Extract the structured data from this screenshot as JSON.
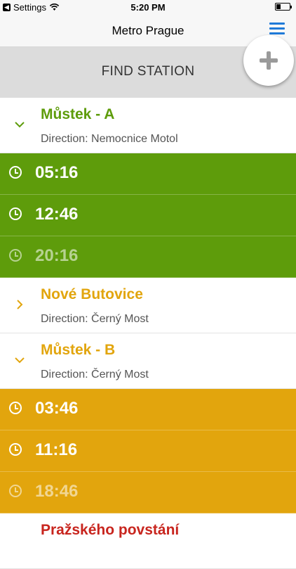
{
  "statusbar": {
    "back_label": "Settings",
    "time": "5:20 PM"
  },
  "navbar": {
    "title": "Metro Prague"
  },
  "find": {
    "label": "FIND STATION"
  },
  "colors": {
    "line_a": "#5e9c0b",
    "line_b": "#e2a50d",
    "line_c": "#c8251e",
    "accent": "#1f7ad8"
  },
  "stations": [
    {
      "name": "Můstek - A",
      "direction": "Direction: Nemocnice Motol",
      "expanded": true,
      "times": [
        "05:16",
        "12:46",
        "20:16"
      ]
    },
    {
      "name": "Nové Butovice",
      "direction": "Direction: Černý Most",
      "expanded": false,
      "times": []
    },
    {
      "name": "Můstek - B",
      "direction": "Direction: Černý Most",
      "expanded": true,
      "times": [
        "03:46",
        "11:16",
        "18:46"
      ]
    },
    {
      "name": "Pražského povstání"
    }
  ]
}
